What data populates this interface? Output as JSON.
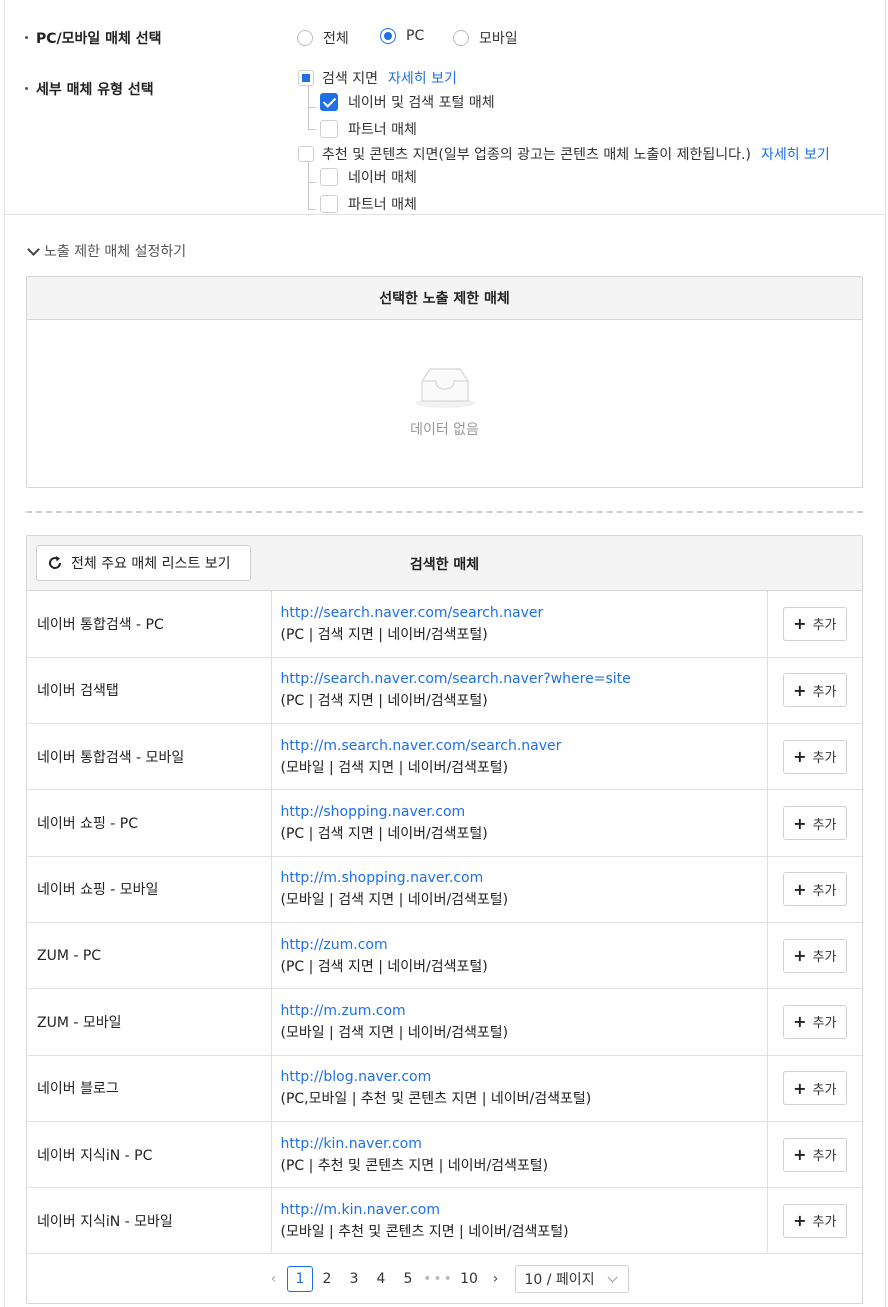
{
  "device": {
    "label": "PC/모바일 매체 선택",
    "options": [
      "전체",
      "PC",
      "모바일"
    ],
    "selected": "PC"
  },
  "detail": {
    "label": "세부 매체 유형 선택",
    "search": {
      "label": "검색 지면",
      "link": "자세히 보기",
      "naver_portal": "네이버 및 검색 포털 매체",
      "partner": "파트너 매체"
    },
    "content": {
      "label": "추천 및 콘텐츠 지면(일부 업종의 광고는 콘텐츠 매체 노출이 제한됩니다.)",
      "link": "자세히 보기",
      "naver": "네이버 매체",
      "partner": "파트너 매체"
    }
  },
  "toggle_label": "노출 제한 매체 설정하기",
  "selected_panel": {
    "title": "선택한 노출 제한 매체",
    "empty_text": "데이터 없음"
  },
  "search_panel": {
    "title": "검색한 매체",
    "refresh_label": "전체 주요 매체 리스트 보기",
    "add_label": "추가",
    "rows": [
      {
        "name": "네이버 통합검색 - PC",
        "url": "http://search.naver.com/search.naver",
        "desc": "(PC | 검색 지면 | 네이버/검색포털)"
      },
      {
        "name": "네이버 검색탭",
        "url": "http://search.naver.com/search.naver?where=site",
        "desc": "(PC | 검색 지면 | 네이버/검색포털)"
      },
      {
        "name": "네이버 통합검색 - 모바일",
        "url": "http://m.search.naver.com/search.naver",
        "desc": "(모바일 | 검색 지면 | 네이버/검색포털)"
      },
      {
        "name": "네이버 쇼핑 - PC",
        "url": "http://shopping.naver.com",
        "desc": "(PC | 검색 지면 | 네이버/검색포털)"
      },
      {
        "name": "네이버 쇼핑 - 모바일",
        "url": "http://m.shopping.naver.com",
        "desc": "(모바일 | 검색 지면 | 네이버/검색포털)"
      },
      {
        "name": "ZUM - PC",
        "url": "http://zum.com",
        "desc": "(PC | 검색 지면 | 네이버/검색포털)"
      },
      {
        "name": "ZUM - 모바일",
        "url": "http://m.zum.com",
        "desc": "(모바일 | 검색 지면 | 네이버/검색포털)"
      },
      {
        "name": "네이버 블로그",
        "url": "http://blog.naver.com",
        "desc": "(PC,모바일 | 추천 및 콘텐츠 지면 | 네이버/검색포털)"
      },
      {
        "name": "네이버 지식iN - PC",
        "url": "http://kin.naver.com",
        "desc": "(PC | 추천 및 콘텐츠 지면 | 네이버/검색포털)"
      },
      {
        "name": "네이버 지식iN - 모바일",
        "url": "http://m.kin.naver.com",
        "desc": "(모바일 | 추천 및 콘텐츠 지면 | 네이버/검색포털)"
      }
    ]
  },
  "pagination": {
    "pages": [
      "1",
      "2",
      "3",
      "4",
      "5"
    ],
    "ellipsis": "•••",
    "last": "10",
    "current": "1",
    "page_size": "10 / 페이지"
  },
  "colors": {
    "accent": "#1e6fe8"
  }
}
